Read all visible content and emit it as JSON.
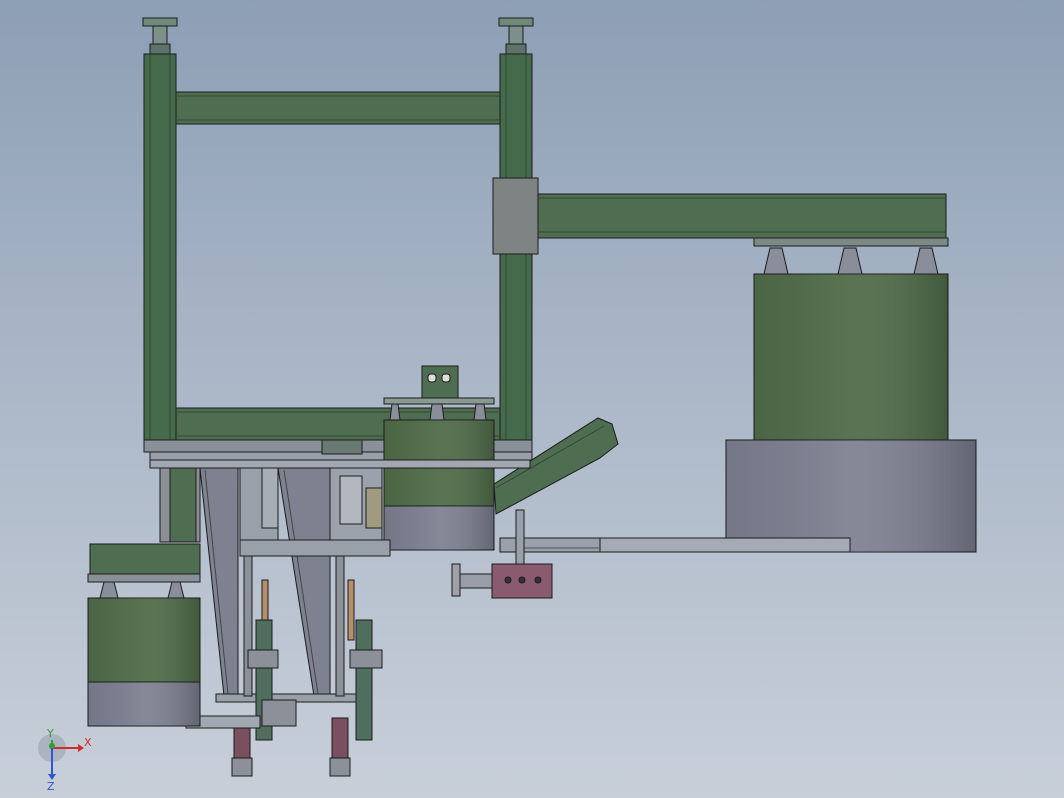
{
  "viewport": {
    "model_colors": {
      "frame": "#4a6b4d",
      "frame_dark": "#2f4a33",
      "cylinder": "#4d6a48",
      "base_gray": "#7c7f8e",
      "purple": "#8a5a6e",
      "outline": "#1c1c1c"
    }
  },
  "triad": {
    "x_label": "X",
    "y_label": "Y",
    "z_label": "Z",
    "x_color": "#d12b2b",
    "y_color": "#2fa02f",
    "z_color": "#2f55d1"
  }
}
